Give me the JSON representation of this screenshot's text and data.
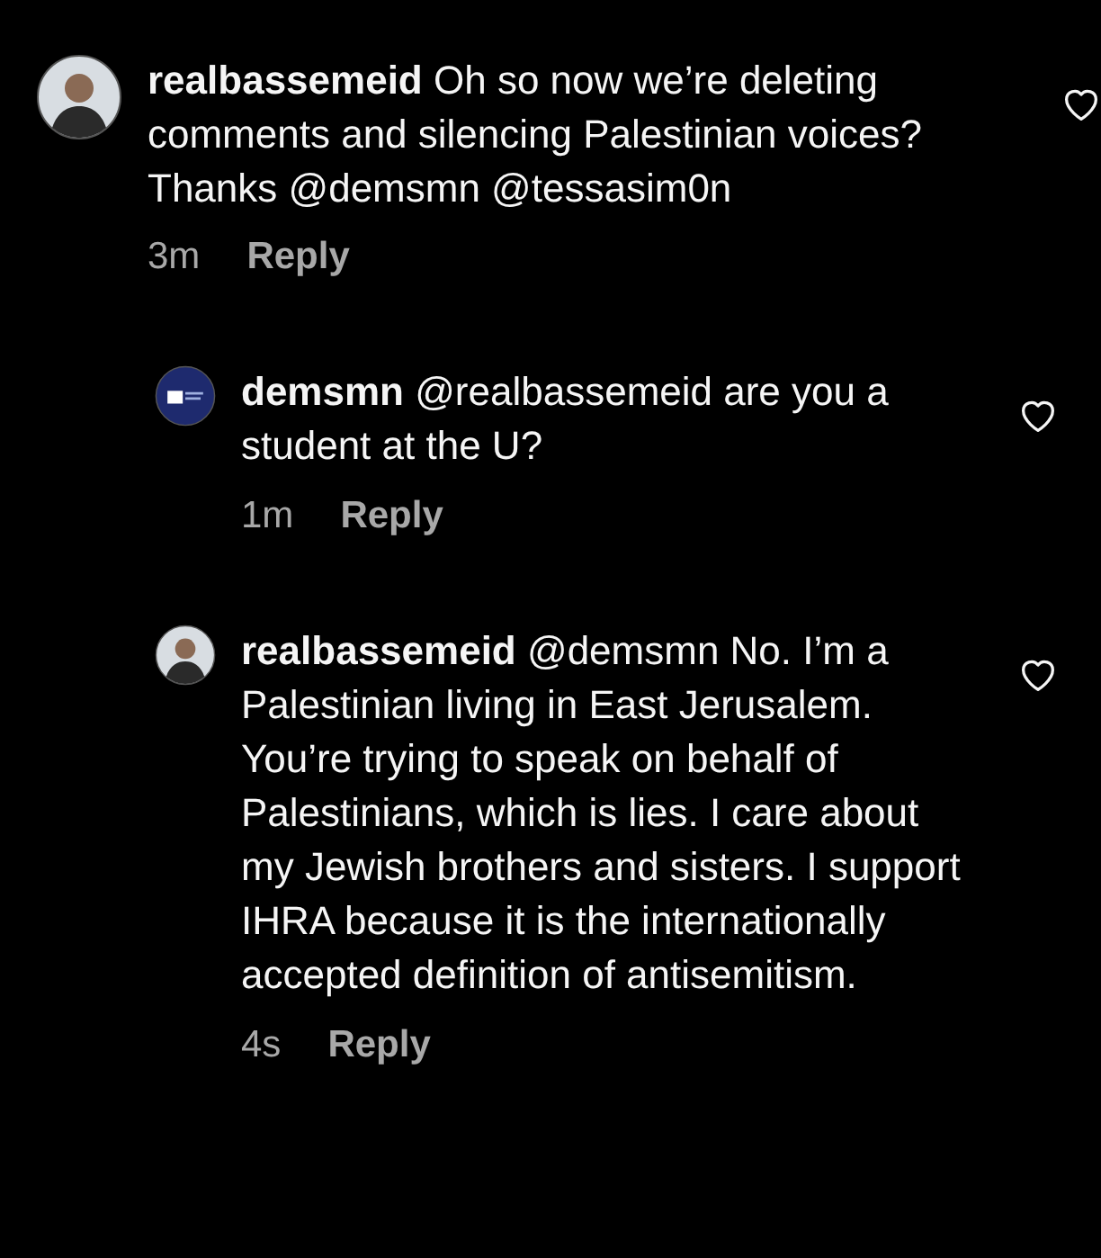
{
  "comments": [
    {
      "avatar": {
        "kind": "photo"
      },
      "username": "realbassemeid",
      "text": "Oh so now we’re deleting comments and silencing Palestinian voices? Thanks @demsmn @tessasim0n",
      "time": "3m",
      "reply_label": "Reply",
      "liked": false,
      "children": [
        {
          "avatar": {
            "kind": "logo"
          },
          "username": "demsmn",
          "text": "@realbassemeid are you a student at the U?",
          "time": "1m",
          "reply_label": "Reply",
          "liked": false
        },
        {
          "avatar": {
            "kind": "photo"
          },
          "username": "realbassemeid",
          "text": "@demsmn No. I’m a Palestinian living in East Jerusalem. You’re trying to speak on behalf of Palestinians, which is lies. I care about my Jewish brothers and sisters. I support IHRA because it is the internationally accepted definition of antisemitism.",
          "time": "4s",
          "reply_label": "Reply",
          "liked": false
        }
      ]
    }
  ]
}
